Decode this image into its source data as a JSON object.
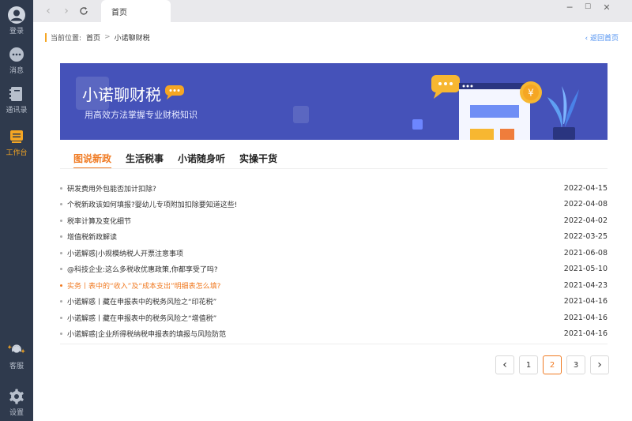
{
  "sidebar": {
    "items": [
      {
        "label": "登录",
        "icon": "user-avatar-icon"
      },
      {
        "label": "消息",
        "icon": "message-icon"
      },
      {
        "label": "通讯录",
        "icon": "contacts-book-icon"
      },
      {
        "label": "工作台",
        "icon": "workbench-icon"
      },
      {
        "label": "客服",
        "icon": "customer-service-icon"
      },
      {
        "label": "设置",
        "icon": "gear-icon"
      }
    ],
    "active_index": 3
  },
  "topbar": {
    "tab_label": "首页",
    "window_buttons": [
      "─",
      "☐",
      "✕"
    ]
  },
  "breadcrumb": {
    "prefix": "当前位置:",
    "items": [
      "首页",
      "小诺聊财税"
    ],
    "back_label": "‹ 返回首页"
  },
  "banner": {
    "title": "小诺聊财税",
    "subtitle": "用高效方法掌握专业财税知识",
    "coin_symbol": "¥"
  },
  "tabs": {
    "items": [
      "图说新政",
      "生活税事",
      "小诺随身听",
      "实操干货"
    ],
    "active_index": 0
  },
  "news": [
    {
      "title": "研发费用外包能否加计扣除?",
      "date": "2022-04-15"
    },
    {
      "title": "个税新政该如何填报?婴幼儿专项附加扣除要知道这些!",
      "date": "2022-04-08"
    },
    {
      "title": "税率计算及变化细节",
      "date": "2022-04-02"
    },
    {
      "title": "增值税新政解读",
      "date": "2022-03-25"
    },
    {
      "title": "小诺解惑|小规模纳税人开票注意事项",
      "date": "2021-06-08"
    },
    {
      "title": "@科技企业:这么多税收优惠政策,你都享受了吗?",
      "date": "2021-05-10"
    },
    {
      "title": "实务丨表中的“收入”及“成本支出”明细表怎么填?",
      "date": "2021-04-23"
    },
    {
      "title": "小诺解惑丨藏在申报表中的税务风险之“印花税”",
      "date": "2021-04-16"
    },
    {
      "title": "小诺解惑丨藏在申报表中的税务风险之“增值税”",
      "date": "2021-04-16"
    },
    {
      "title": "小诺解惑|企业所得税纳税申报表的填报与风险防范",
      "date": "2021-04-16"
    }
  ],
  "highlight_index": 6,
  "pagination": {
    "prev": "‹",
    "next": "›",
    "pages": [
      "1",
      "2",
      "3"
    ],
    "current": "2"
  },
  "colors": {
    "accent": "#f07a22",
    "sidebar_bg": "#2f3a4d",
    "banner_bg": "#4552b9",
    "link": "#4a8ef0"
  }
}
